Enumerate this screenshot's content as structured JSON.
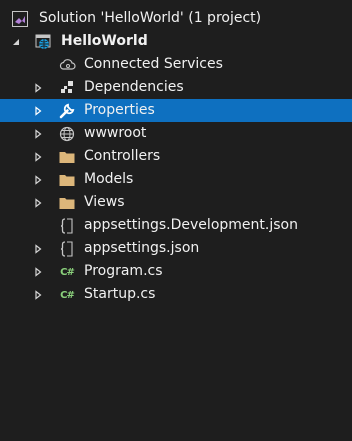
{
  "solution": {
    "label": "Solution 'HelloWorld' (1 project)"
  },
  "project": {
    "label": "HelloWorld"
  },
  "items": [
    {
      "label": "Connected Services",
      "icon": "cloud-icon"
    },
    {
      "label": "Dependencies",
      "icon": "dependencies-icon"
    },
    {
      "label": "Properties",
      "icon": "wrench-icon"
    },
    {
      "label": "wwwroot",
      "icon": "globe-icon"
    },
    {
      "label": "Controllers",
      "icon": "folder-icon"
    },
    {
      "label": "Models",
      "icon": "folder-icon"
    },
    {
      "label": "Views",
      "icon": "folder-icon"
    },
    {
      "label": "appsettings.Development.json",
      "icon": "json-file-icon"
    },
    {
      "label": "appsettings.json",
      "icon": "json-file-icon"
    },
    {
      "label": "Program.cs",
      "icon": "csharp-file-icon",
      "badge": "C#"
    },
    {
      "label": "Startup.cs",
      "icon": "csharp-file-icon",
      "badge": "C#"
    }
  ],
  "colors": {
    "background": "#1e1e1e",
    "selection": "#0e70c0",
    "text": "#f1f1f1",
    "folder": "#dcb67a",
    "csharp": "#8bd17c"
  }
}
